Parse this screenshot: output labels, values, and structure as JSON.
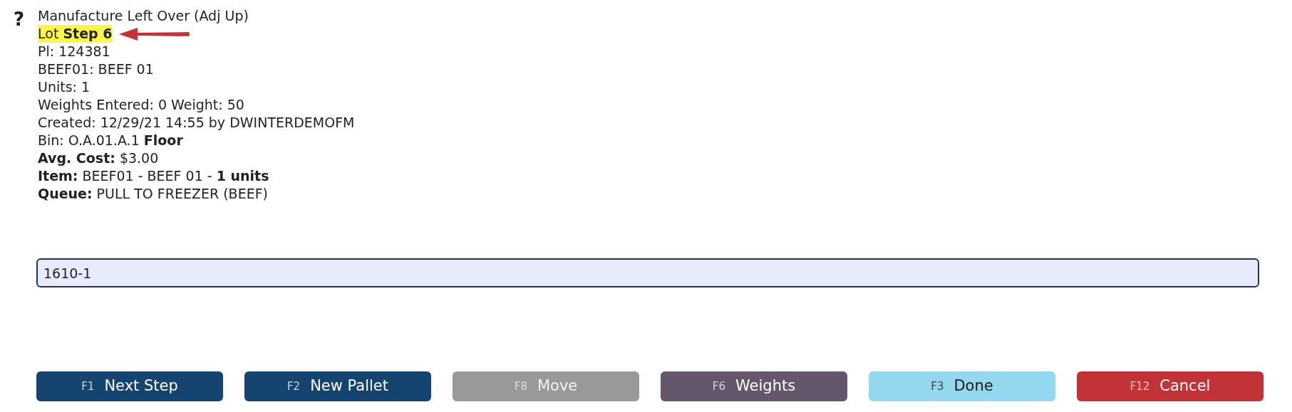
{
  "help_icon": "?",
  "title": "Manufacture Left Over (Adj Up)",
  "lines": [
    {
      "text": "Lot **Step 6**",
      "highlighted": true
    },
    {
      "text": "Pl: 124381",
      "highlighted": false
    },
    {
      "text": "BEEF01: BEEF 01",
      "highlighted": false
    },
    {
      "text": "Units: 1",
      "highlighted": false
    },
    {
      "text": "Weights Entered: 0 Weight: 50",
      "highlighted": false
    },
    {
      "text": "Created: 12/29/21 14:55 by DWINTERDEMOFM",
      "highlighted": false
    },
    {
      "text": "Bin: O.A.01.A.1 **Floor**",
      "highlighted": false
    },
    {
      "text": "**Avg. Cost:** $3.00",
      "highlighted": false
    },
    {
      "text": "**Item:** BEEF01 - BEEF 01 - **1 units**",
      "highlighted": false
    },
    {
      "text": "**Queue:** PULL TO FREEZER (BEEF)",
      "highlighted": false
    }
  ],
  "scan_field": {
    "value": "1610-1"
  },
  "buttons": [
    {
      "key": "F1",
      "label": "Next Step",
      "kind": "primary"
    },
    {
      "key": "F2",
      "label": "New Pallet",
      "kind": "primary"
    },
    {
      "key": "F8",
      "label": "Move",
      "kind": "disabled"
    },
    {
      "key": "F6",
      "label": "Weights",
      "kind": "secondary"
    },
    {
      "key": "F3",
      "label": "Done",
      "kind": "info"
    },
    {
      "key": "F12",
      "label": "Cancel",
      "kind": "danger"
    }
  ]
}
